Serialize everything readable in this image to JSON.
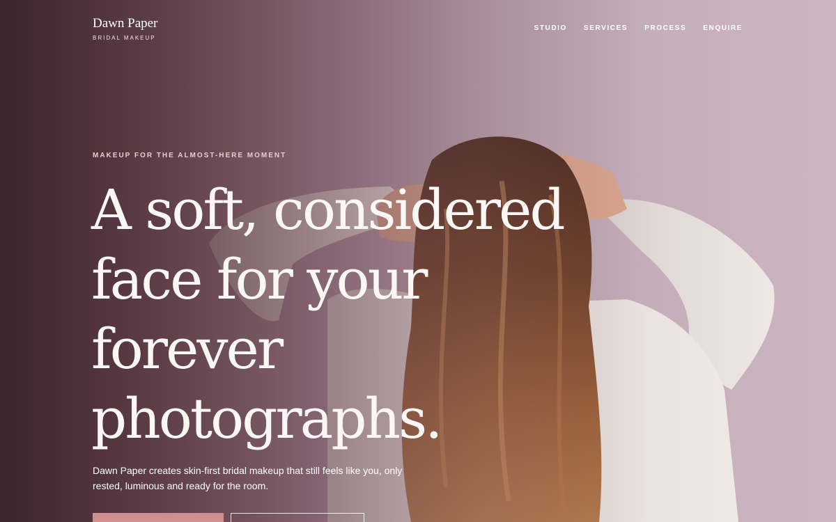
{
  "brand": {
    "name": "Dawn Paper",
    "tagline": "BRIDAL MAKEUP"
  },
  "nav": {
    "items": [
      {
        "label": "STUDIO"
      },
      {
        "label": "SERVICES"
      },
      {
        "label": "PROCESS"
      },
      {
        "label": "ENQUIRE"
      }
    ]
  },
  "hero": {
    "eyebrow": "MAKEUP FOR THE ALMOST-HERE MOMENT",
    "headline": "A soft, considered face for your forever photographs.",
    "lede": "Dawn Paper creates skin-first bridal makeup that still feels like you, only rested, luminous and ready for the room.",
    "cta_primary": "",
    "cta_secondary": ""
  },
  "colors": {
    "accent": "#d08f8c",
    "eyebrow": "#f0c9cf",
    "backdrop": "#c4adb8"
  }
}
